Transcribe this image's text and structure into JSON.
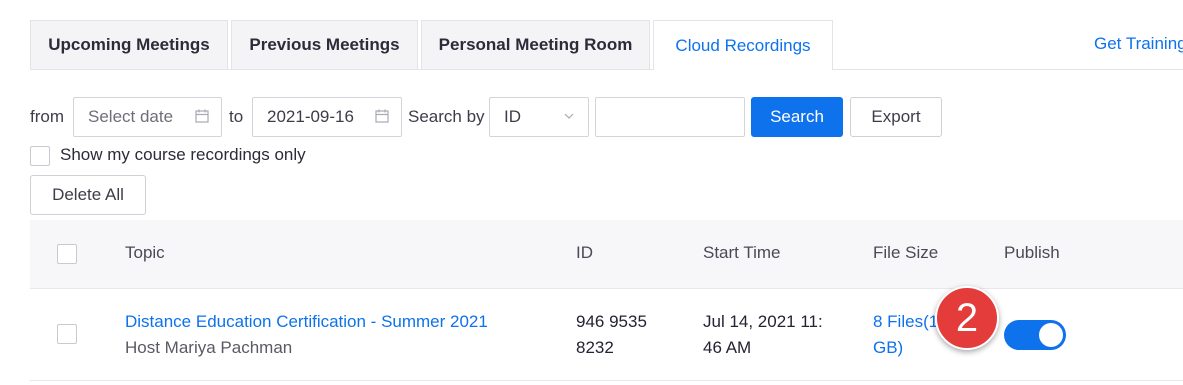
{
  "tabs": [
    {
      "label": "Upcoming Meetings"
    },
    {
      "label": "Previous Meetings"
    },
    {
      "label": "Personal Meeting Room"
    },
    {
      "label": "Cloud Recordings",
      "active": true
    }
  ],
  "get_training": "Get Training",
  "filters": {
    "from_label": "from",
    "from_placeholder": "Select date",
    "to_label": "to",
    "to_value": "2021-09-16",
    "search_by_label": "Search by",
    "search_by_value": "ID",
    "search_input_value": "",
    "search_button": "Search",
    "export_button": "Export",
    "course_only_label": "Show my course recordings only",
    "delete_all_button": "Delete All"
  },
  "table": {
    "headers": {
      "topic": "Topic",
      "id": "ID",
      "start_time": "Start Time",
      "file_size": "File Size",
      "publish": "Publish"
    },
    "rows": [
      {
        "topic": "Distance Education Certification - Summer 2021",
        "host": "Host Mariya Pachman",
        "id_line1": "946 9535",
        "id_line2": "8232",
        "start_line1": "Jul 14, 2021 11:",
        "start_line2": "46 AM",
        "files_line1": "8 Files(1",
        "files_line2": "GB)",
        "published": true
      }
    ]
  },
  "annotation_badge": "2",
  "colors": {
    "accent": "#0e72ed",
    "badge": "#e43b3b"
  }
}
